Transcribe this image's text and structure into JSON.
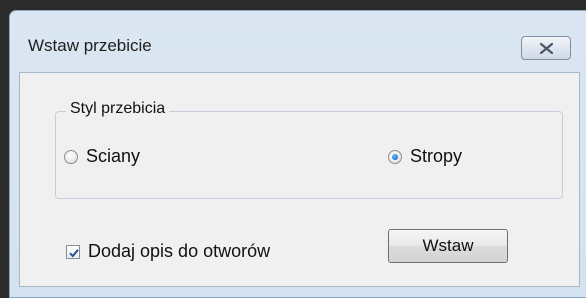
{
  "window": {
    "title": "Wstaw przebicie"
  },
  "icons": {
    "close": "close-icon",
    "check": "check-icon"
  },
  "group": {
    "legend": "Styl przebicia",
    "options": [
      {
        "label": "Sciany",
        "selected": false
      },
      {
        "label": "Stropy",
        "selected": true
      }
    ]
  },
  "options": {
    "add_description_label": "Dodaj opis do otworów",
    "add_description_checked": true
  },
  "buttons": {
    "insert_label": "Wstaw"
  },
  "colors": {
    "accent": "#1d6fd6",
    "frame": "#d4e1ee"
  }
}
